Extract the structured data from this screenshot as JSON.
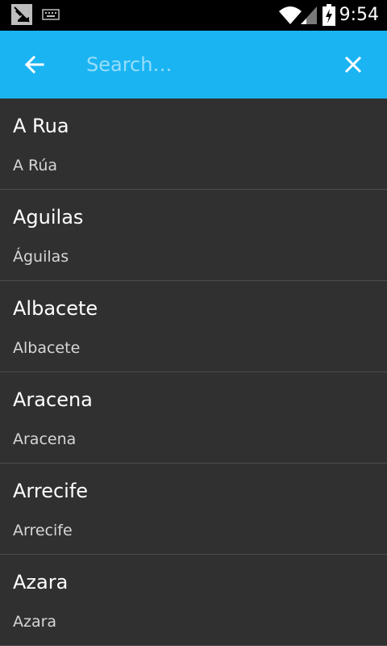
{
  "status_bar": {
    "time": "9:54",
    "icons": [
      "notification-icon",
      "keyboard-icon",
      "wifi-icon",
      "signal-icon",
      "battery-charging-icon"
    ]
  },
  "app_bar": {
    "back_icon": "arrow-left-icon",
    "search_placeholder": "Search…",
    "search_value": "",
    "clear_icon": "close-icon",
    "color": "#1ab4f3"
  },
  "results": [
    {
      "title": "A Rua",
      "subtitle": "A Rúa"
    },
    {
      "title": "Aguilas",
      "subtitle": "Águilas"
    },
    {
      "title": "Albacete",
      "subtitle": "Albacete"
    },
    {
      "title": "Aracena",
      "subtitle": "Aracena"
    },
    {
      "title": "Arrecife",
      "subtitle": "Arrecife"
    },
    {
      "title": "Azara",
      "subtitle": "Azara"
    }
  ]
}
